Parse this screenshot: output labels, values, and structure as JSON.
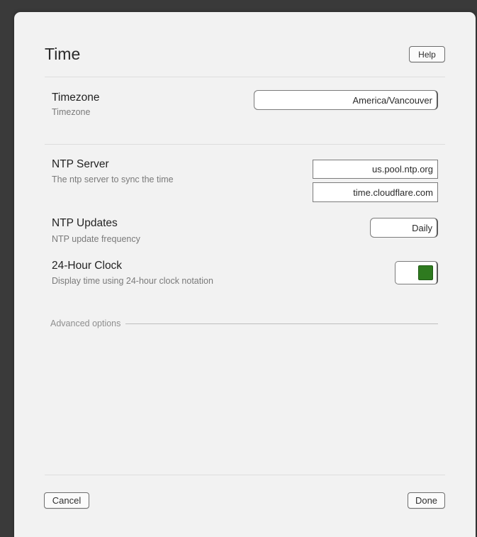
{
  "dialog": {
    "title": "Time",
    "help_label": "Help",
    "cancel_label": "Cancel",
    "done_label": "Done"
  },
  "timezone": {
    "label": "Timezone",
    "description": "Timezone",
    "value": "America/Vancouver"
  },
  "ntp_server": {
    "label": "NTP Server",
    "description": "The ntp server to sync the time",
    "servers": [
      "us.pool.ntp.org",
      "time.cloudflare.com"
    ]
  },
  "ntp_updates": {
    "label": "NTP Updates",
    "description": "NTP update frequency",
    "value": "Daily"
  },
  "clock_24h": {
    "label": "24-Hour Clock",
    "description": "Display time using 24-hour clock notation",
    "enabled": true,
    "accent_color": "#2e7a1f"
  },
  "advanced": {
    "label": "Advanced options"
  }
}
